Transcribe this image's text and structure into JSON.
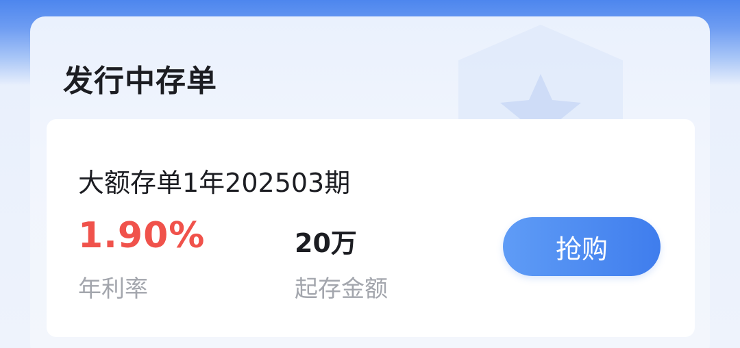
{
  "colors": {
    "accent": "#4a86ef",
    "rate": "#f0524b",
    "text_primary": "#1c1d22",
    "text_secondary": "#a3a6ad",
    "card": "#ffffff"
  },
  "section": {
    "title": "发行中存单",
    "icon": "shield-star-icon"
  },
  "product": {
    "name": "大额存单1年202503期",
    "rate_value": "1.90%",
    "rate_label": "年利率",
    "amount_value": "20万",
    "amount_label": "起存金额",
    "buy_label": "抢购"
  }
}
